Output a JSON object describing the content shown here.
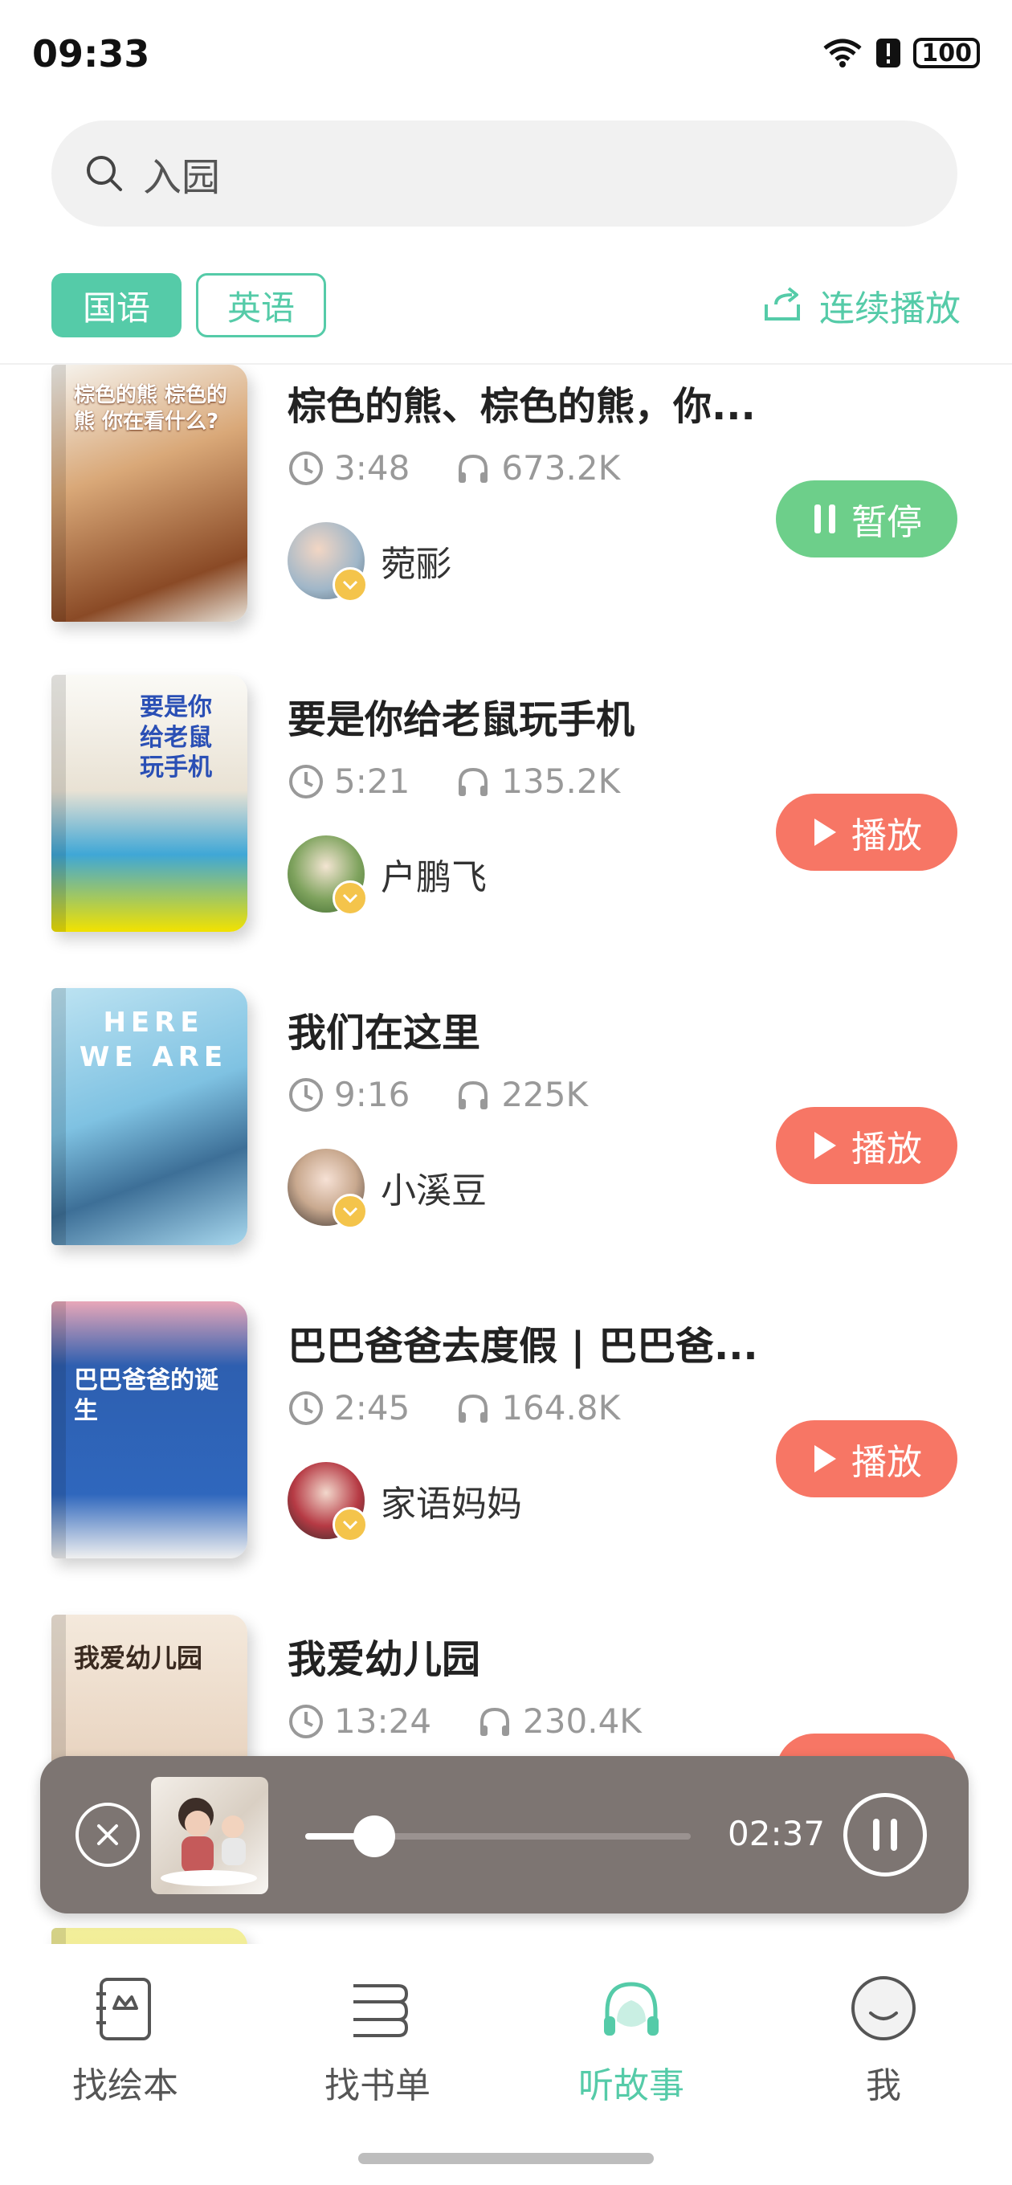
{
  "status_bar": {
    "time": "09:33",
    "battery": "100"
  },
  "search": {
    "query": "入园"
  },
  "filters": {
    "tabs": [
      {
        "label": "国语",
        "active": true
      },
      {
        "label": "英语",
        "active": false
      }
    ],
    "continuous_play": "连续播放"
  },
  "stories": [
    {
      "title": "棕色的熊、棕色的熊，你...",
      "duration": "3:48",
      "plays": "673.2K",
      "author": "菀彨",
      "action": "暂停",
      "state": "playing",
      "cover_text": "棕色的熊 棕色的熊 你在看什么?"
    },
    {
      "title": "要是你给老鼠玩手机",
      "duration": "5:21",
      "plays": "135.2K",
      "author": "户鹏飞",
      "action": "播放",
      "state": "idle",
      "cover_text": "要是你给老鼠玩手机"
    },
    {
      "title": "我们在这里",
      "duration": "9:16",
      "plays": "225K",
      "author": "小溪豆",
      "action": "播放",
      "state": "idle",
      "cover_text": "HERE WE ARE"
    },
    {
      "title": "巴巴爸爸去度假 | 巴巴爸...",
      "duration": "2:45",
      "plays": "164.8K",
      "author": "家语妈妈",
      "action": "播放",
      "state": "idle",
      "cover_text": "巴巴爸爸的诞生"
    },
    {
      "title": "我爱幼儿园",
      "duration": "13:24",
      "plays": "230.4K",
      "author": "",
      "action": "播放",
      "state": "idle",
      "cover_text": "我爱幼儿园"
    }
  ],
  "player": {
    "time": "02:37",
    "progress": 0.18
  },
  "tabbar": [
    {
      "label": "找绘本",
      "active": false,
      "icon": "picture-book-icon"
    },
    {
      "label": "找书单",
      "active": false,
      "icon": "booklist-icon"
    },
    {
      "label": "听故事",
      "active": true,
      "icon": "headphones-icon"
    },
    {
      "label": "我",
      "active": false,
      "icon": "profile-smile-icon"
    }
  ],
  "colors": {
    "accent": "#55cba8",
    "play": "#f77665",
    "pause": "#6dcf8a",
    "player_bg": "#7d7572"
  }
}
